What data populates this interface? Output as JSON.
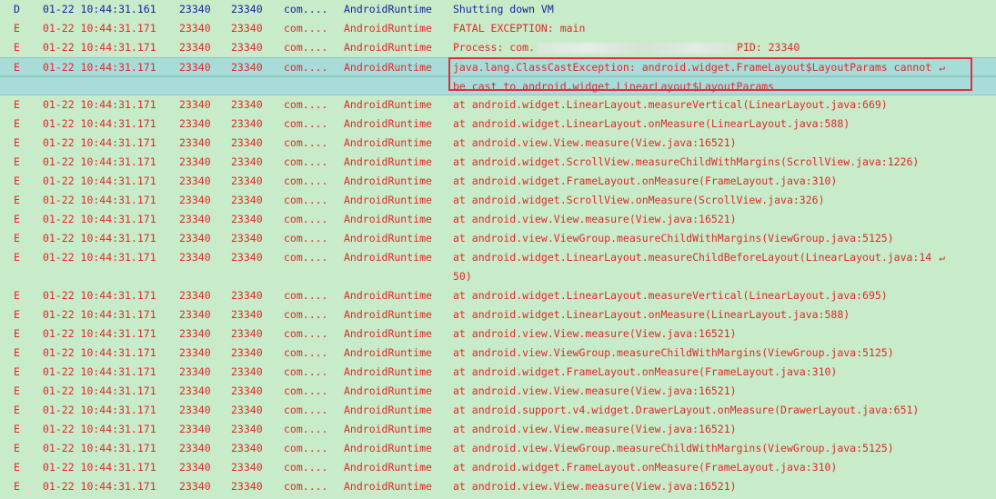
{
  "log": {
    "rows": [
      {
        "level": "D",
        "time": "01-22 10:44:31.161",
        "pid": "23340",
        "tid": "23340",
        "app": "com....",
        "tag": "AndroidRuntime",
        "text": "Shutting down VM"
      },
      {
        "level": "E",
        "time": "01-22 10:44:31.171",
        "pid": "23340",
        "tid": "23340",
        "app": "com....",
        "tag": "AndroidRuntime",
        "text": "FATAL EXCEPTION: main"
      },
      {
        "level": "E",
        "time": "01-22 10:44:31.171",
        "pid": "23340",
        "tid": "23340",
        "app": "com....",
        "tag": "AndroidRuntime",
        "text": "Process: com.",
        "text_suffix": "PID: 23340"
      },
      {
        "level": "E",
        "time": "01-22 10:44:31.171",
        "pid": "23340",
        "tid": "23340",
        "app": "com....",
        "tag": "AndroidRuntime",
        "text": "java.lang.ClassCastException: android.widget.FrameLayout$LayoutParams cannot"
      },
      {
        "level": "",
        "time": "",
        "pid": "",
        "tid": "",
        "app": "",
        "tag": "",
        "text": "be cast to android.widget.LinearLayout$LayoutParams"
      },
      {
        "level": "E",
        "time": "01-22 10:44:31.171",
        "pid": "23340",
        "tid": "23340",
        "app": "com....",
        "tag": "AndroidRuntime",
        "text": "at android.widget.LinearLayout.measureVertical(LinearLayout.java:669)"
      },
      {
        "level": "E",
        "time": "01-22 10:44:31.171",
        "pid": "23340",
        "tid": "23340",
        "app": "com....",
        "tag": "AndroidRuntime",
        "text": "at android.widget.LinearLayout.onMeasure(LinearLayout.java:588)"
      },
      {
        "level": "E",
        "time": "01-22 10:44:31.171",
        "pid": "23340",
        "tid": "23340",
        "app": "com....",
        "tag": "AndroidRuntime",
        "text": "at android.view.View.measure(View.java:16521)"
      },
      {
        "level": "E",
        "time": "01-22 10:44:31.171",
        "pid": "23340",
        "tid": "23340",
        "app": "com....",
        "tag": "AndroidRuntime",
        "text": "at android.widget.ScrollView.measureChildWithMargins(ScrollView.java:1226)"
      },
      {
        "level": "E",
        "time": "01-22 10:44:31.171",
        "pid": "23340",
        "tid": "23340",
        "app": "com....",
        "tag": "AndroidRuntime",
        "text": "at android.widget.FrameLayout.onMeasure(FrameLayout.java:310)"
      },
      {
        "level": "E",
        "time": "01-22 10:44:31.171",
        "pid": "23340",
        "tid": "23340",
        "app": "com....",
        "tag": "AndroidRuntime",
        "text": "at android.widget.ScrollView.onMeasure(ScrollView.java:326)"
      },
      {
        "level": "E",
        "time": "01-22 10:44:31.171",
        "pid": "23340",
        "tid": "23340",
        "app": "com....",
        "tag": "AndroidRuntime",
        "text": "at android.view.View.measure(View.java:16521)"
      },
      {
        "level": "E",
        "time": "01-22 10:44:31.171",
        "pid": "23340",
        "tid": "23340",
        "app": "com....",
        "tag": "AndroidRuntime",
        "text": "at android.view.ViewGroup.measureChildWithMargins(ViewGroup.java:5125)"
      },
      {
        "level": "E",
        "time": "01-22 10:44:31.171",
        "pid": "23340",
        "tid": "23340",
        "app": "com....",
        "tag": "AndroidRuntime",
        "text": "at android.widget.LinearLayout.measureChildBeforeLayout(LinearLayout.java:14"
      },
      {
        "level": "",
        "time": "",
        "pid": "",
        "tid": "",
        "app": "",
        "tag": "",
        "text": "50)"
      },
      {
        "level": "E",
        "time": "01-22 10:44:31.171",
        "pid": "23340",
        "tid": "23340",
        "app": "com....",
        "tag": "AndroidRuntime",
        "text": "at android.widget.LinearLayout.measureVertical(LinearLayout.java:695)"
      },
      {
        "level": "E",
        "time": "01-22 10:44:31.171",
        "pid": "23340",
        "tid": "23340",
        "app": "com....",
        "tag": "AndroidRuntime",
        "text": "at android.widget.LinearLayout.onMeasure(LinearLayout.java:588)"
      },
      {
        "level": "E",
        "time": "01-22 10:44:31.171",
        "pid": "23340",
        "tid": "23340",
        "app": "com....",
        "tag": "AndroidRuntime",
        "text": "at android.view.View.measure(View.java:16521)"
      },
      {
        "level": "E",
        "time": "01-22 10:44:31.171",
        "pid": "23340",
        "tid": "23340",
        "app": "com....",
        "tag": "AndroidRuntime",
        "text": "at android.view.ViewGroup.measureChildWithMargins(ViewGroup.java:5125)"
      },
      {
        "level": "E",
        "time": "01-22 10:44:31.171",
        "pid": "23340",
        "tid": "23340",
        "app": "com....",
        "tag": "AndroidRuntime",
        "text": "at android.widget.FrameLayout.onMeasure(FrameLayout.java:310)"
      },
      {
        "level": "E",
        "time": "01-22 10:44:31.171",
        "pid": "23340",
        "tid": "23340",
        "app": "com....",
        "tag": "AndroidRuntime",
        "text": "at android.view.View.measure(View.java:16521)"
      },
      {
        "level": "E",
        "time": "01-22 10:44:31.171",
        "pid": "23340",
        "tid": "23340",
        "app": "com....",
        "tag": "AndroidRuntime",
        "text": "at android.support.v4.widget.DrawerLayout.onMeasure(DrawerLayout.java:651)"
      },
      {
        "level": "E",
        "time": "01-22 10:44:31.171",
        "pid": "23340",
        "tid": "23340",
        "app": "com....",
        "tag": "AndroidRuntime",
        "text": "at android.view.View.measure(View.java:16521)"
      },
      {
        "level": "E",
        "time": "01-22 10:44:31.171",
        "pid": "23340",
        "tid": "23340",
        "app": "com....",
        "tag": "AndroidRuntime",
        "text": "at android.view.ViewGroup.measureChildWithMargins(ViewGroup.java:5125)"
      },
      {
        "level": "E",
        "time": "01-22 10:44:31.171",
        "pid": "23340",
        "tid": "23340",
        "app": "com....",
        "tag": "AndroidRuntime",
        "text": "at android.widget.FrameLayout.onMeasure(FrameLayout.java:310)"
      },
      {
        "level": "E",
        "time": "01-22 10:44:31.171",
        "pid": "23340",
        "tid": "23340",
        "app": "com....",
        "tag": "AndroidRuntime",
        "text": "at android.view.View.measure(View.java:16521)"
      }
    ],
    "wrap_icon": "wrap-arrow-icon",
    "colors": {
      "background": "#c8ebc9",
      "selected_row": "#a7dcd9",
      "error_text": "#e02a2a",
      "debug_text": "#16279a",
      "highlight_box": "#e1303a"
    }
  }
}
